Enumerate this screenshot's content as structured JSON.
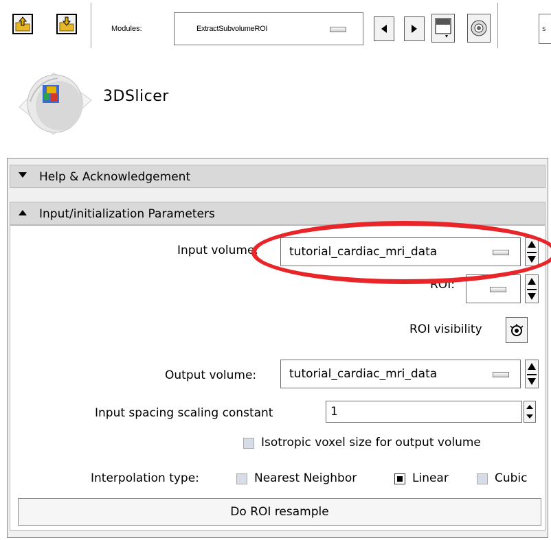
{
  "toolbar": {
    "modules_label": "Modules:",
    "module_selected": "ExtractSubvolumeROI",
    "search_stub": "s"
  },
  "logo": {
    "app_name": "3DSlicer"
  },
  "help_panel": {
    "title": "Help & Acknowledgement",
    "collapsed": true
  },
  "params_panel": {
    "title": "Input/initialization Parameters",
    "input_volume_label": "Input volume:",
    "input_volume_value": "tutorial_cardiac_mri_data",
    "roi_label": "ROI:",
    "roi_value": "",
    "roi_visibility_label": "ROI visibility",
    "output_volume_label": "Output volume:",
    "output_volume_value": "tutorial_cardiac_mri_data",
    "spacing_label": "Input spacing scaling constant",
    "spacing_value": "1",
    "isotropic_label": "Isotropic voxel size for output volume",
    "isotropic_checked": false,
    "interpolation_label": "Interpolation type:",
    "interpolation_options": [
      {
        "label": "Nearest Neighbor",
        "checked": false
      },
      {
        "label": "Linear",
        "checked": true
      },
      {
        "label": "Cubic",
        "checked": false
      }
    ],
    "resample_button": "Do ROI resample"
  },
  "colors": {
    "annotation_ellipse": "#e8262a",
    "header_bg": "#d9d9d9",
    "panel_bg": "#f0f0f0"
  }
}
